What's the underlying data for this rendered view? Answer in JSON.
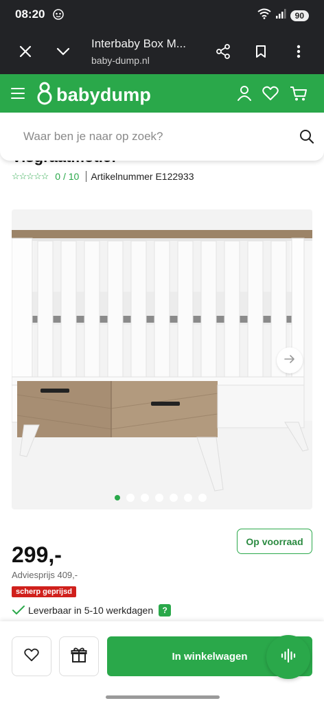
{
  "status_bar": {
    "time": "08:20",
    "battery": "90"
  },
  "browser": {
    "title": "Interbaby Box M...",
    "url": "baby-dump.nl"
  },
  "site": {
    "logo_text": "babydump"
  },
  "search": {
    "placeholder": "Waar ben je naar op zoek?"
  },
  "product": {
    "title": "Visgraatmotief",
    "stars": "☆☆☆☆☆",
    "rating": "0 / 10",
    "article_number": "Artikelnummer  E122933",
    "gallery_images": 7,
    "gallery_active_index": 0,
    "stock_label": "Op voorraad",
    "price": "299,-",
    "advice_price": "Adviesprijs 409,-",
    "sale_badge": "scherp geprijsd",
    "delivery": "Leverbaar in 5-10 werkdagen",
    "help": "?"
  },
  "actions": {
    "add_to_cart": "In winkelwagen"
  },
  "colors": {
    "brand_green": "#2aa84a",
    "sale_red": "#d0201c",
    "dark_bar": "#222326"
  },
  "icons": [
    "close-icon",
    "chevron-down-icon",
    "share-icon",
    "bookmark-icon",
    "more-vert-icon",
    "menu-icon",
    "user-icon",
    "heart-icon",
    "cart-icon",
    "search-icon",
    "arrow-right-icon",
    "check-icon",
    "gift-icon",
    "voice-icon"
  ]
}
